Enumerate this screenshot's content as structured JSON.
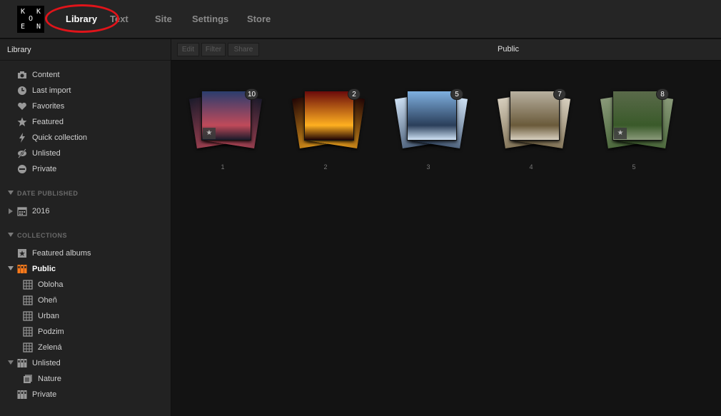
{
  "topnav": {
    "logo_letters": [
      "K",
      "K",
      "O",
      "E",
      "N"
    ],
    "items": [
      {
        "label": "Library",
        "active": true
      },
      {
        "label": "Text",
        "active": false
      },
      {
        "label": "Site",
        "active": false
      },
      {
        "label": "Settings",
        "active": false
      },
      {
        "label": "Store",
        "active": false
      }
    ],
    "highlight_color": "#e0141a"
  },
  "sidebar": {
    "title": "Library",
    "library_items": [
      {
        "label": "Content",
        "icon": "camera-icon"
      },
      {
        "label": "Last import",
        "icon": "clock-icon"
      },
      {
        "label": "Favorites",
        "icon": "heart-icon"
      },
      {
        "label": "Featured",
        "icon": "star-icon"
      },
      {
        "label": "Quick collection",
        "icon": "lightning-icon"
      },
      {
        "label": "Unlisted",
        "icon": "eye-slash-icon"
      },
      {
        "label": "Private",
        "icon": "minus-circle-icon"
      }
    ],
    "date_section": "DATE PUBLISHED",
    "date_items": [
      {
        "label": "2016",
        "icon": "calendar-icon"
      }
    ],
    "collections_section": "COLLECTIONS",
    "collection_items": [
      {
        "label": "Featured albums",
        "icon": "star-album-icon",
        "level": 0
      },
      {
        "label": "Public",
        "icon": "sets-orange-icon",
        "level": 0,
        "selected": true
      },
      {
        "label": "Obloha",
        "icon": "grid-icon",
        "level": 1
      },
      {
        "label": "Oheň",
        "icon": "grid-icon",
        "level": 1
      },
      {
        "label": "Urban",
        "icon": "grid-icon",
        "level": 1
      },
      {
        "label": "Podzim",
        "icon": "grid-icon",
        "level": 1
      },
      {
        "label": "Zelená",
        "icon": "grid-icon",
        "level": 1
      },
      {
        "label": "Unlisted",
        "icon": "sets-icon",
        "level": 0
      },
      {
        "label": "Nature",
        "icon": "album-stack-icon",
        "level": 1
      },
      {
        "label": "Private",
        "icon": "sets-icon",
        "level": 0
      }
    ],
    "accent": "#ff7a1a"
  },
  "toolbar": {
    "edit_label": "Edit",
    "filter_label": "Filter",
    "share_label": "Share",
    "title": "Public"
  },
  "albums": [
    {
      "label": "1",
      "count": "10",
      "featured": true,
      "colors": [
        "#2b3d6e",
        "#c04a5a",
        "#1a1a2a"
      ]
    },
    {
      "label": "2",
      "count": "2",
      "featured": false,
      "colors": [
        "#6a0a0a",
        "#ffb020",
        "#200404"
      ]
    },
    {
      "label": "3",
      "count": "5",
      "featured": false,
      "colors": [
        "#7fb0e0",
        "#2a3e5a",
        "#cfe2f5"
      ]
    },
    {
      "label": "4",
      "count": "7",
      "featured": false,
      "colors": [
        "#b8b0a0",
        "#6a5a3a",
        "#d8d0c0"
      ]
    },
    {
      "label": "5",
      "count": "8",
      "featured": true,
      "colors": [
        "#5a6a4a",
        "#3a5a2a",
        "#8a9a7a"
      ]
    }
  ]
}
